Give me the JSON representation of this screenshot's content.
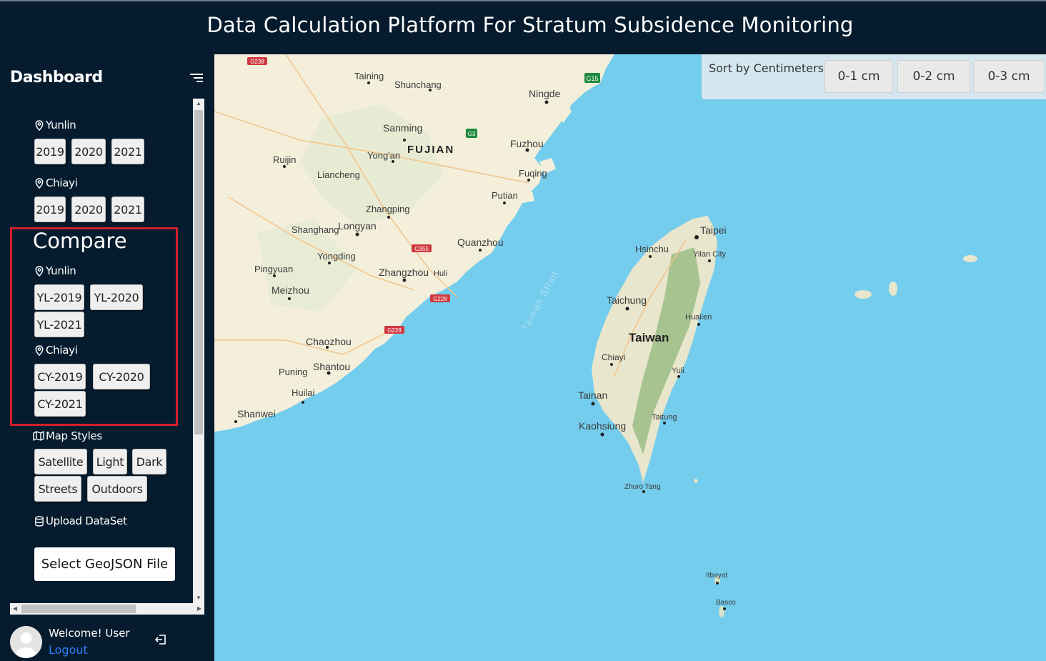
{
  "header": {
    "title": "Data Calculation Platform For Stratum Subsidence Monitoring"
  },
  "sidebar": {
    "title": "Dashboard",
    "groups": [
      {
        "location": "Yunlin",
        "years": [
          "2019",
          "2020",
          "2021"
        ]
      },
      {
        "location": "Chiayi",
        "years": [
          "2019",
          "2020",
          "2021"
        ]
      }
    ],
    "compare": {
      "title": "Compare",
      "yunlin": {
        "location": "Yunlin",
        "items": [
          "YL-2019",
          "YL-2020",
          "YL-2021"
        ]
      },
      "chiayi": {
        "location": "Chiayi",
        "items": [
          "CY-2019",
          "CY-2020",
          "CY-2021"
        ]
      }
    },
    "map_styles": {
      "label": "Map Styles",
      "options": [
        "Satellite",
        "Light",
        "Dark",
        "Streets",
        "Outdoors"
      ]
    },
    "upload": {
      "label": "Upload DataSet",
      "button": "Select GeoJSON File"
    },
    "user": {
      "welcome": "Welcome! User",
      "logout": "Logout"
    }
  },
  "sort": {
    "label": "Sort by Centimeters:",
    "options": [
      "0-1 cm",
      "0-2 cm",
      "0-3 cm"
    ]
  },
  "map_labels": {
    "fujian": "FUJIAN",
    "taiwan": "Taiwan",
    "strait": "Taiwan Strait",
    "cities": [
      "Taining",
      "Shunchang",
      "Ningde",
      "Sanming",
      "Fuzhou",
      "Yong'an",
      "Ruijin",
      "Liancheng",
      "Fuqing",
      "Putian",
      "Zhangping",
      "Shanghang",
      "Longyan",
      "Quanzhou",
      "Yongding",
      "Pingyuan",
      "Zhangzhou",
      "Huli",
      "Meizhou",
      "Chaozhou",
      "Shantou",
      "Puning",
      "Huilai",
      "Shanwei",
      "Taipei",
      "Hsinchu",
      "Yilan City",
      "Taichung",
      "Hualien",
      "Chiayi",
      "Yuli",
      "Tainan",
      "Taitung",
      "Kaohsiung",
      "Zhuro Tang",
      "Itbayat",
      "Basco"
    ],
    "roads": [
      "G238",
      "G15",
      "G3",
      "G355",
      "G228",
      "G228"
    ]
  },
  "colors": {
    "header_bg": "#061c2e",
    "map_water": "#75cdee",
    "land": "#f3efdb",
    "highlight": "#d3202a",
    "link": "#2e7cf6"
  }
}
